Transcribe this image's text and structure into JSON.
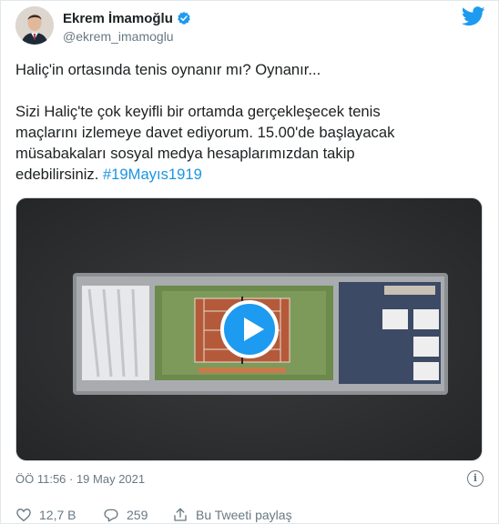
{
  "author": {
    "display_name": "Ekrem İmamoğlu",
    "handle": "@ekrem_imamoglu",
    "verified": true
  },
  "tweet": {
    "line1": "Haliç'in ortasında tenis oynanır mı? Oynanır...",
    "line2a": "Sizi Haliç'te çok keyifli bir ortamda gerçekleşecek tenis",
    "line2b": "maçlarını izlemeye davet ediyorum. 15.00'de başlayacak",
    "line2c": "müsabakaları sosyal medya hesaplarımızdan takip",
    "line2d": "edebilirsiniz.",
    "hashtag": "#19Mayıs1919"
  },
  "meta": {
    "timestamp": "ÖÖ 11:56 · 19 May 2021",
    "info_icon": "i"
  },
  "actions": {
    "likes": "12,7 B",
    "replies": "259",
    "share_label": "Bu Tweeti paylaş"
  },
  "colors": {
    "accent": "#1d9bf0",
    "hashtag": "#1b95e0",
    "secondary_text": "#697882"
  }
}
